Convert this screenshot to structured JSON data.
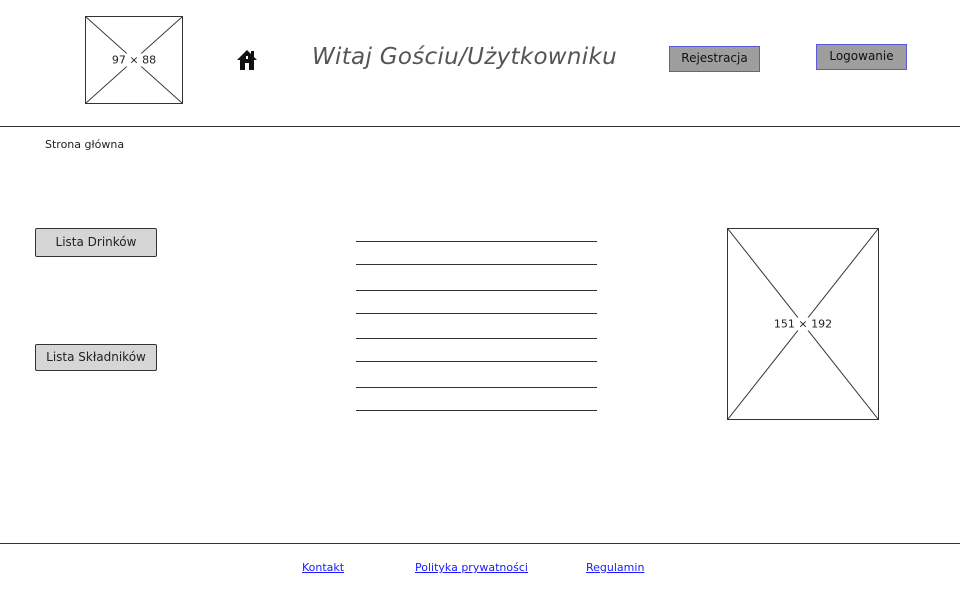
{
  "header": {
    "logo_placeholder_label": "97 × 88",
    "home_icon": "home-icon",
    "title": "Witaj Gościu/Użytkowniku",
    "register_label": "Rejestracja",
    "login_label": "Logowanie"
  },
  "breadcrumb": {
    "label": "Strona główna"
  },
  "sidebar": {
    "items": [
      {
        "label": "Lista Drinków"
      },
      {
        "label": "Lista Składników"
      }
    ]
  },
  "main": {
    "text_lines_count": 8
  },
  "aside": {
    "image_placeholder_label": "151 × 192"
  },
  "footer": {
    "links": [
      {
        "label": "Kontakt"
      },
      {
        "label": "Polityka prywatności"
      },
      {
        "label": "Regulamin"
      }
    ]
  },
  "colors": {
    "button_fill": "#9e9e9e",
    "button_border": "#5a5ad8",
    "side_button_fill": "#d6d6d6",
    "link": "#1a1aff"
  }
}
